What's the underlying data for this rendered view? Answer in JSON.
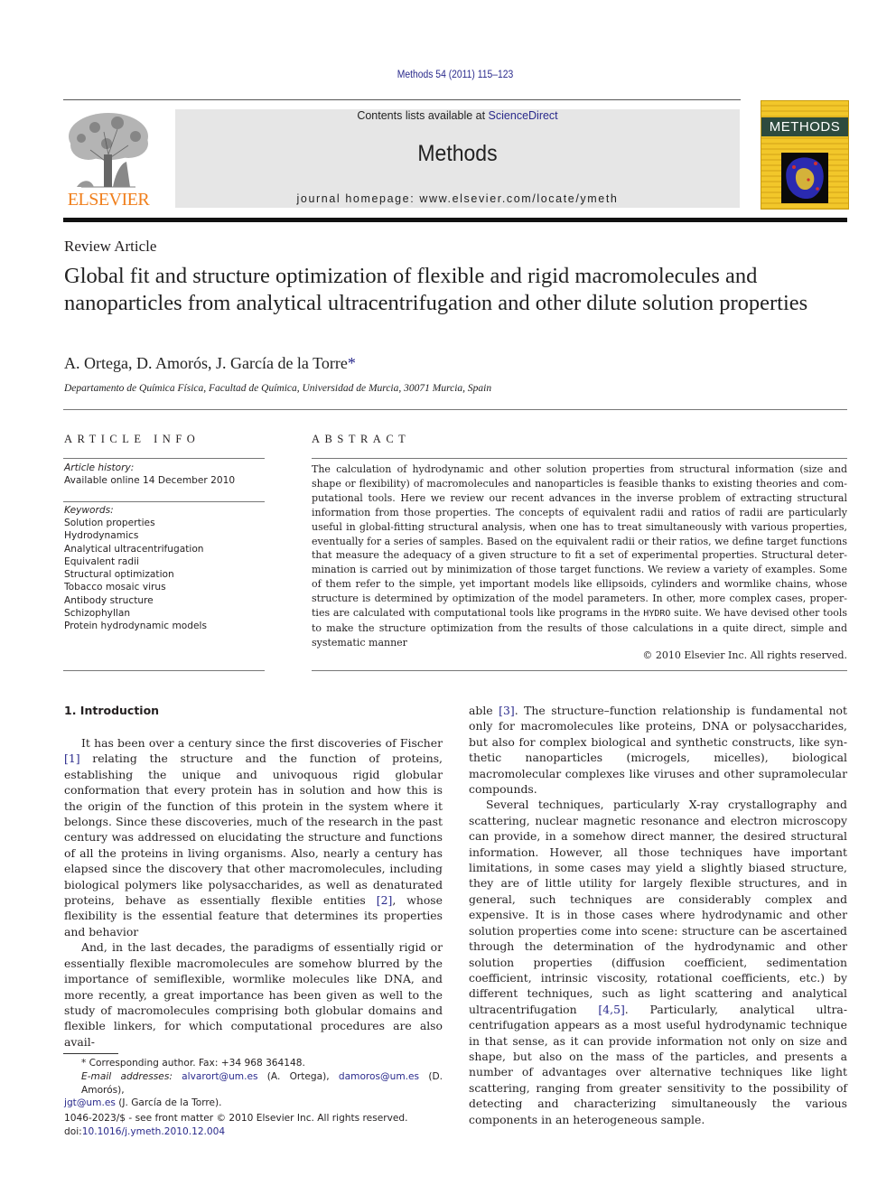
{
  "header": {
    "journal_ref": "Methods 54 (2011) 115–123",
    "contents_prefix": "Contents lists available at ",
    "contents_link": "ScienceDirect",
    "journal_name": "Methods",
    "homepage": "journal homepage: www.elsevier.com/locate/ymeth",
    "publisher_logo": "ELSEVIER",
    "cover_title": "METHODS",
    "colors": {
      "link": "#2a2a8c",
      "elsevier_orange": "#f07f1c",
      "banner_bg": "#e6e6e6",
      "cover_yellow": "#f2c72a"
    }
  },
  "article": {
    "type": "Review Article",
    "title": "Global fit and structure optimization of flexible and rigid macromolecules and nanoparticles from analytical ultracentrifugation and other dilute solution properties",
    "authors": "A. Ortega, D. Amorós, J. García de la Torre",
    "corresponding_mark": "*",
    "affiliation": "Departamento de Química Física, Facultad de Química, Universidad de Murcia, 30071 Murcia, Spain"
  },
  "article_info": {
    "heading": "ARTICLE INFO",
    "history_label": "Article history:",
    "history_value": "Available online 14 December 2010",
    "keywords_label": "Keywords:",
    "keywords": [
      "Solution properties",
      "Hydrodynamics",
      "Analytical ultracentrifugation",
      "Equivalent radii",
      "Structural optimization",
      "Tobacco mosaic virus",
      "Antibody structure",
      "Schizophyllan",
      "Protein hydrodynamic models"
    ]
  },
  "abstract": {
    "heading": "ABSTRACT",
    "text_before": "The calculation of hydrodynamic and other solution properties from structural information (size and shape or flexibility) of macromolecules and nanoparticles is feasible thanks to existing theories and com­putational tools. Here we review our recent advances in the inverse problem of extracting structural information from those properties. The concepts of equivalent radii and ratios of radii are particularly useful in global-fitting structural analysis, when one has to treat simultaneously with various properties, eventually for a series of samples. Based on the equivalent radii or their ratios, we define target functions that measure the adequacy of a given structure to fit a set of experimental properties. Structural deter­mination is carried out by minimization of those target functions. We review a variety of examples. Some of them refer to the simple, yet important models like ellipsoids, cylinders and wormlike chains, whose structure is determined by optimization of the model parameters. In other, more complex cases, proper­ties are calculated with computational tools like programs in the ",
    "program_name": "HYDRO",
    "text_after": " suite. We have devised other tools to make the structure optimization from the results of those calculations in a quite direct, simple and systematic manner",
    "copyright": "© 2010 Elsevier Inc. All rights reserved."
  },
  "introduction": {
    "heading": "1. Introduction",
    "p1_a": "It has been over a century since the first discoveries of Fischer ",
    "ref1": "[1]",
    "p1_b": " relating the structure and the function of proteins, establishing the unique and univoquous rigid globular conformation that every protein has in solution and how this is the origin of the function of this protein in the system where it belongs. Since these discoveries, much of the research in the past century was addressed on eluci­dating the structure and functions of all the proteins in living organisms. Also, nearly a century has elapsed since the discovery that other macromolecules, including biological polymers like polysaccharides, as well as denaturated proteins, behave as essen­tially flexible entities ",
    "ref2": "[2]",
    "p1_c": ", whose flexibility is the essential feature that determines its properties and behavior",
    "p2": "And, in the last decades, the paradigms of essentially rigid or essentially flexible macromolecules are somehow blurred by the importance of semiflexible, wormlike molecules like DNA, and more recently, a great importance has been given as well to the study of macromolecules comprising both globular domains and flexible linkers, for which computational procedures are also avail-",
    "p2_cont_a": "able ",
    "ref3": "[3]",
    "p2_cont_b": ". The structure–function relationship is fundamental not only for macromolecules like proteins, DNA or polysaccharides, but also for complex biological and synthetic constructs, like syn­thetic nanoparticles (microgels, micelles), biological macromolecu­lar complexes like viruses and other supramolecular compounds.",
    "p3_a": "Several techniques, particularly X-ray crystallography and scat­tering, nuclear magnetic resonance and electron microscopy can provide, in a somehow direct manner, the desired structural infor­mation. However, all those techniques have important limitations, in some cases may yield a slightly biased structure, they are of little utility for largely flexible structures, and in general, such tech­niques are considerably complex and expensive. It is in those cases where hydrodynamic and other solution properties come into scene: structure can be ascertained through the determination of the hydrodynamic and other solution properties (diffusion coeffi­cient, sedimentation coefficient, intrinsic viscosity, rotational coef­ficients, etc.) by different techniques, such as light scattering and analytical ultracentrifugation ",
    "ref45": "[4,5]",
    "p3_b": ". Particularly, analytical ultra­centrifugation appears as a most useful hydrodynamic technique in that sense, as it can provide information not only on size and shape, but also on the mass of the particles, and presents a number of advantages over alternative techniques like light scattering, ranging from greater sensitivity to the possibility of detecting and characterizing simultaneously the various components in an heterogeneous sample."
  },
  "footnote": {
    "star": "*",
    "corresponding": " Corresponding author. Fax: +34 968 364148.",
    "email_label": "E-mail addresses:",
    "emails": [
      {
        "address": "alvarort@um.es",
        "name": " (A. Ortega), "
      },
      {
        "address": "damoros@um.es",
        "name": " (D. Amorós), "
      },
      {
        "address": "jgt@um.es",
        "name": " (J. García de la Torre)."
      }
    ]
  },
  "issn": {
    "line": "1046-2023/$ - see front matter © 2010 Elsevier Inc. All rights reserved.",
    "doi_prefix": "doi:",
    "doi": "10.1016/j.ymeth.2010.12.004"
  }
}
